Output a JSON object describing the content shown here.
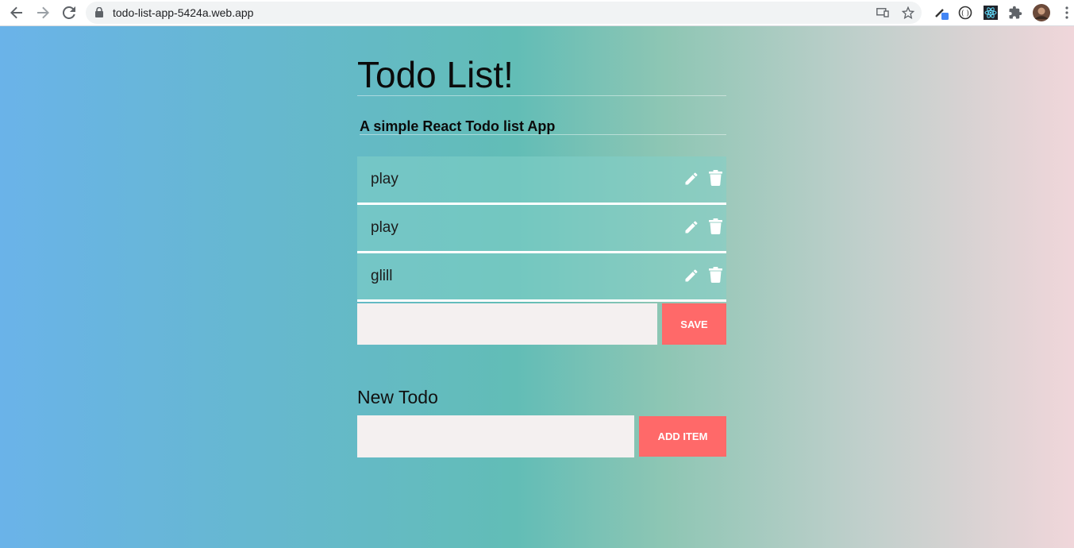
{
  "browser": {
    "url": "todo-list-app-5424a.web.app"
  },
  "page": {
    "title": "Todo List!",
    "subtitle": "A simple React Todo list App",
    "todos": [
      {
        "text": "play"
      },
      {
        "text": "play"
      },
      {
        "text": "glill"
      }
    ],
    "edit": {
      "value": "",
      "save_label": "SAVE"
    },
    "new_todo": {
      "label": "New Todo",
      "value": "",
      "add_label": "ADD ITEM"
    },
    "colors": {
      "button": "#ff6969",
      "input_bg": "#f4f0f0",
      "gradient_left": "#6ab3e9",
      "gradient_mid": "#62bdb6",
      "gradient_right": "#f0d6da"
    }
  }
}
